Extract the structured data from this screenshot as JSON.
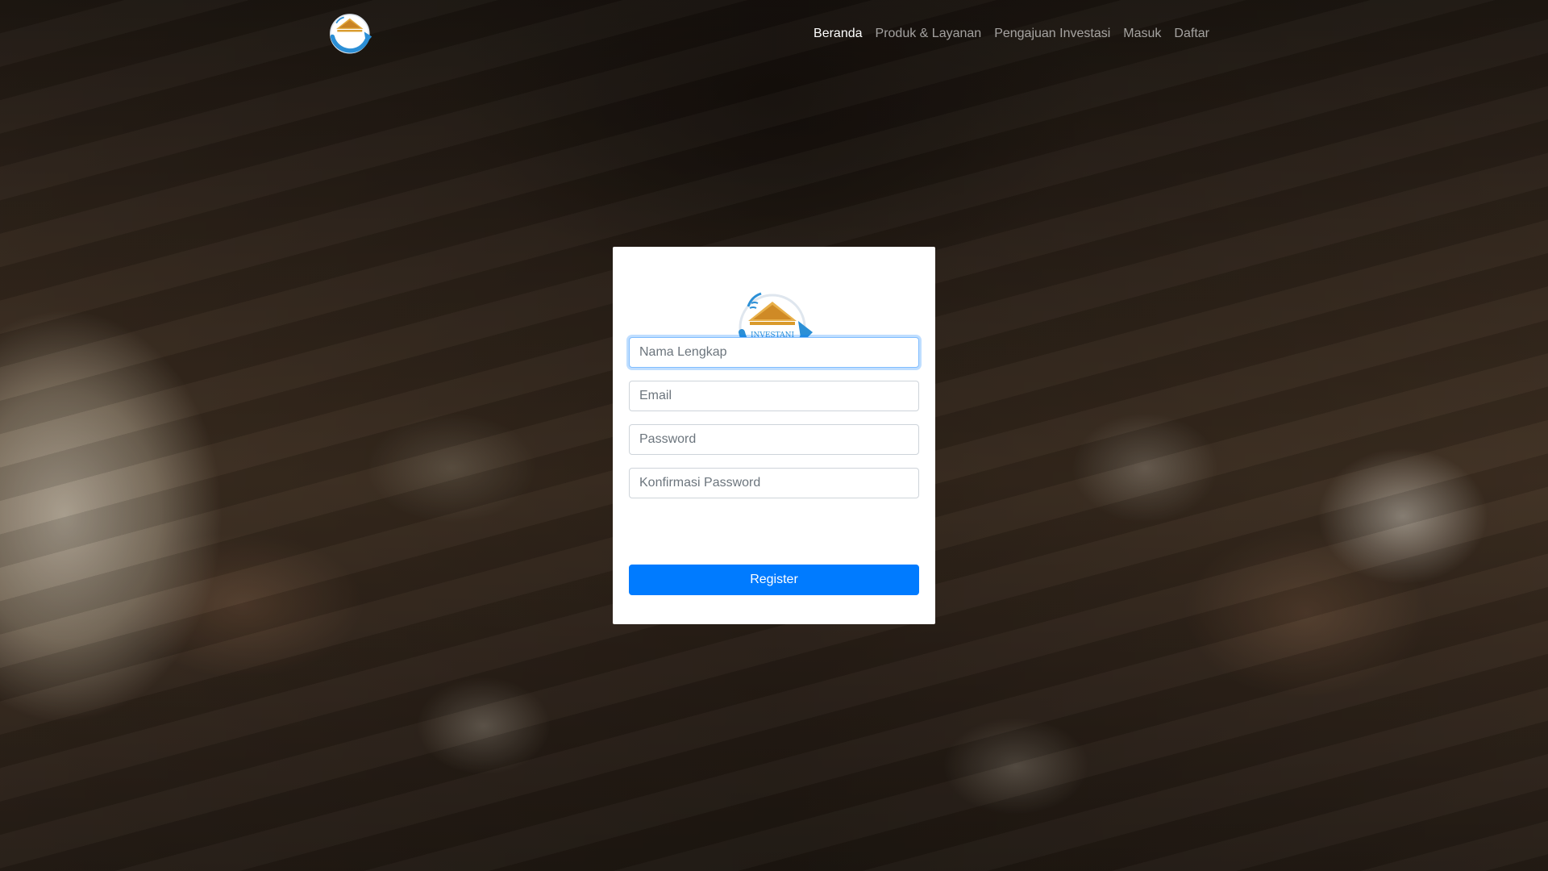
{
  "brand": {
    "logo_icon": "investani-logo-icon",
    "logo_text": "INVESTANI"
  },
  "nav": {
    "items": [
      {
        "label": "Beranda",
        "active": true
      },
      {
        "label": "Produk & Layanan",
        "active": false
      },
      {
        "label": "Pengajuan Investasi",
        "active": false
      },
      {
        "label": "Masuk",
        "active": false
      },
      {
        "label": "Daftar",
        "active": false
      }
    ]
  },
  "register_form": {
    "full_name": {
      "value": "",
      "placeholder": "Nama Lengkap"
    },
    "email": {
      "value": "",
      "placeholder": "Email"
    },
    "password": {
      "value": "",
      "placeholder": "Password"
    },
    "confirm_password": {
      "value": "",
      "placeholder": "Konfirmasi Password"
    },
    "submit_label": "Register"
  },
  "colors": {
    "primary": "#007bff",
    "focus_border": "#80bdff",
    "logo_blue": "#2b8fd6",
    "logo_gold": "#d99a2b",
    "nav_active": "#ffffff",
    "nav_inactive": "rgba(255,255,255,0.6)"
  }
}
